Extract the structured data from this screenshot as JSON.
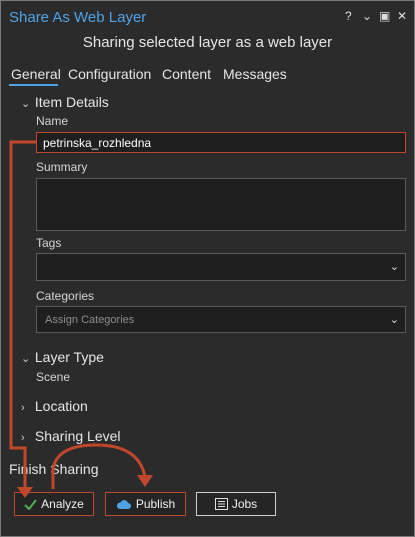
{
  "window": {
    "title": "Share As Web Layer",
    "subtitle": "Sharing selected layer as a web layer",
    "controls": {
      "help": "?",
      "menu": "⌄",
      "restore": "▣",
      "close": "✕"
    }
  },
  "tabs": [
    {
      "label": "General",
      "selected": true
    },
    {
      "label": "Configuration"
    },
    {
      "label": "Content"
    },
    {
      "label": "Messages"
    }
  ],
  "item_details": {
    "heading": "Item Details",
    "name_label": "Name",
    "name_value": "petrinska_rozhledna",
    "summary_label": "Summary",
    "tags_label": "Tags",
    "categories_label": "Categories",
    "categories_placeholder": "Assign Categories"
  },
  "layer_type": {
    "heading": "Layer Type",
    "value": "Scene"
  },
  "location": {
    "heading": "Location"
  },
  "sharing_level": {
    "heading": "Sharing Level"
  },
  "finish": {
    "heading": "Finish Sharing",
    "analyze_label": "Analyze",
    "publish_label": "Publish",
    "jobs_label": "Jobs"
  },
  "icons": {
    "expanded": "chevron-down-icon",
    "collapsed": "chevron-right-icon",
    "analyze": "checkmark-icon",
    "publish": "cloud-icon",
    "jobs": "list-icon"
  },
  "colors": {
    "accent": "#4ea3e6",
    "annotation": "#c0472b",
    "check": "#4caf50",
    "background": "#2b2b2b"
  }
}
